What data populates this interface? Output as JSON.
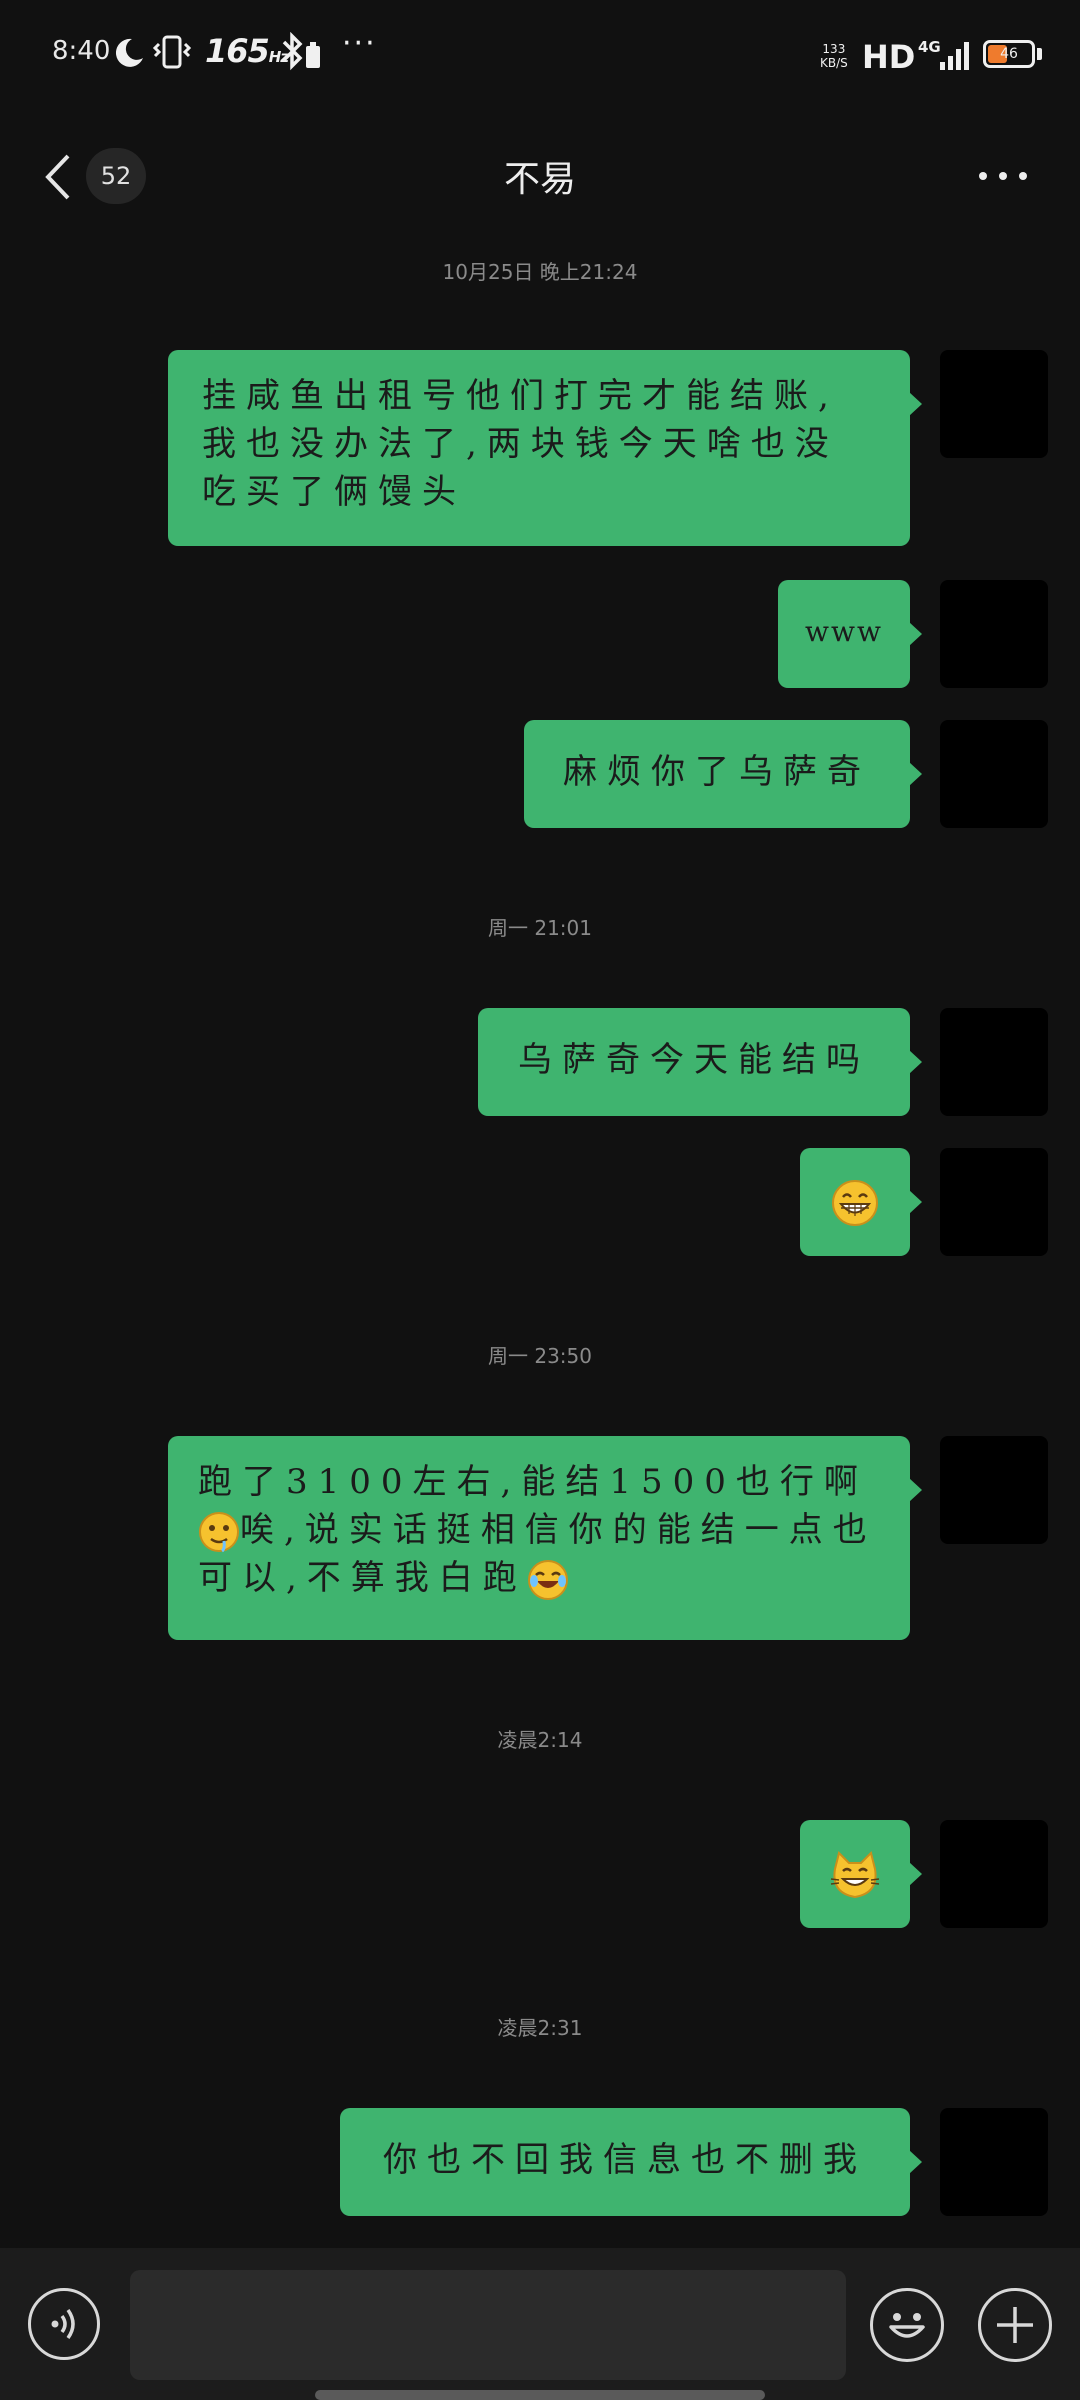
{
  "status_bar": {
    "time": "8:40",
    "refresh_rate": "165",
    "refresh_unit": "Hz",
    "speed_value": "133",
    "speed_unit": "KB/S",
    "hd": "HD",
    "network": "4G",
    "battery": "46"
  },
  "header": {
    "unread_count": "52",
    "title": "不易"
  },
  "messages": [
    {
      "type": "time",
      "text": "10月25日 晚上21:24"
    },
    {
      "type": "text",
      "text": "挂咸鱼出租号他们打完才能结账,我也没办法了,两块钱今天啥也没吃买了俩馒头"
    },
    {
      "type": "text",
      "text": "www"
    },
    {
      "type": "text",
      "text": "麻烦你了乌萨奇"
    },
    {
      "type": "time",
      "text": "周一 21:01"
    },
    {
      "type": "text",
      "text": "乌萨奇今天能结吗"
    },
    {
      "type": "emoji",
      "name": "grin-emoji"
    },
    {
      "type": "time",
      "text": "周一 23:50"
    },
    {
      "type": "text",
      "part1": "跑了3100左右,能结1500也行啊",
      "part2": "唉,说实话挺相信你的能结一点也可以,不算我白跑",
      "part3": ""
    },
    {
      "type": "time",
      "text": "凌晨2:14"
    },
    {
      "type": "emoji",
      "name": "cat-emoji"
    },
    {
      "type": "time",
      "text": "凌晨2:31"
    },
    {
      "type": "text",
      "text": "你也不回我信息也不删我"
    }
  ],
  "input": {
    "placeholder": "",
    "value": ""
  },
  "colors": {
    "bubble": "#3fb46f",
    "background": "#111111",
    "battery_accent": "#ef7b2d"
  }
}
